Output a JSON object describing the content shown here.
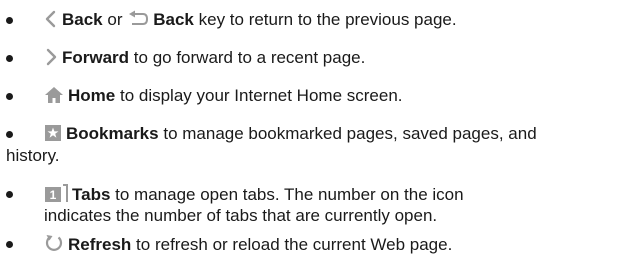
{
  "items": [
    {
      "icon": "chevron-left-icon",
      "title": "Back",
      "connector": "or",
      "icon2": "back-key-icon",
      "title2": "Back",
      "desc": "key to return to the previous page."
    },
    {
      "icon": "chevron-right-icon",
      "title": "Forward",
      "desc": "to go forward to a recent page."
    },
    {
      "icon": "home-icon",
      "title": "Home",
      "desc": "to display your Internet Home screen."
    },
    {
      "icon": "bookmark-star-icon",
      "title": "Bookmarks",
      "desc_line1": "to manage bookmarked pages, saved pages, and",
      "desc_line2": "history."
    },
    {
      "icon": "tabs-icon",
      "icon_text": "1",
      "title": "Tabs",
      "desc_line1": "to manage open tabs. The number on the icon",
      "desc_line2": "indicates the number of tabs that are currently open."
    },
    {
      "icon": "refresh-icon",
      "title": "Refresh",
      "desc": "to refresh or reload the current Web page."
    }
  ],
  "colors": {
    "icon": "#9a9a9a",
    "text": "#1a1a1a"
  }
}
